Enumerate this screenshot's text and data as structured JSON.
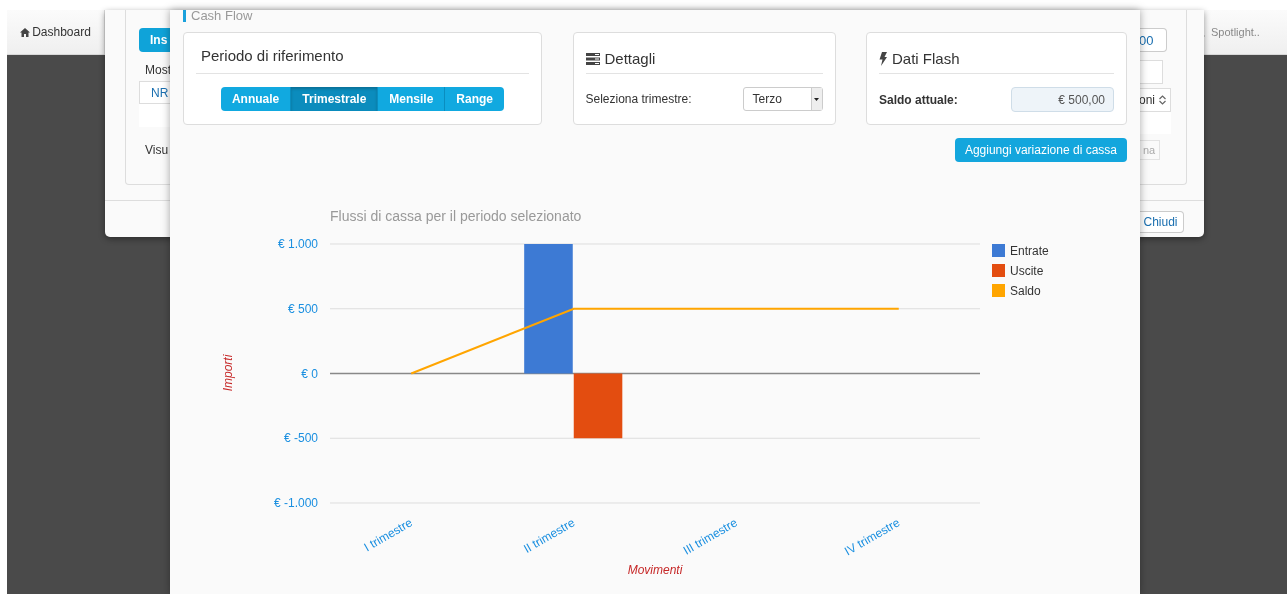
{
  "navbar": {
    "dashboard_button": "Dashboard",
    "search": {
      "placeholder": "Spotlight.."
    }
  },
  "background_modal": {
    "left_button": "Ins",
    "left_text_1": "Most",
    "table_header": "NR",
    "left_text_2": "Visu",
    "right_field_value": "00",
    "right_select_value": "oni",
    "right_button": {
      "label": "na",
      "disabled": true
    },
    "close_button": "Chiudi"
  },
  "modal": {
    "title": "Cash Flow",
    "period_panel": {
      "title": "Periodo di riferimento",
      "options": [
        {
          "label": "Annuale",
          "selected": false
        },
        {
          "label": "Trimestrale",
          "selected": true
        },
        {
          "label": "Mensile",
          "selected": false
        },
        {
          "label": "Range",
          "selected": false
        }
      ]
    },
    "details_panel": {
      "title": "Dettagli",
      "label": "Seleziona trimestre:",
      "select_value": "Terzo"
    },
    "flash_panel": {
      "title": "Dati Flash",
      "label": "Saldo attuale:",
      "value": "€ 500,00"
    },
    "add_button": "Aggiungi variazione di cassa",
    "chart": {
      "chart_data": {
        "type": "bar",
        "title": "Flussi di cassa per il periodo selezionato",
        "xlabel": "Movimenti",
        "ylabel": "Importi",
        "categories": [
          "I trimestre",
          "II trimestre",
          "III trimestre",
          "IV trimestre"
        ],
        "series": [
          {
            "name": "Entrate",
            "color": "#3d7ad4",
            "values": [
              0,
              1000,
              0,
              0
            ]
          },
          {
            "name": "Uscite",
            "color": "#e34d10",
            "values": [
              0,
              -500,
              0,
              0
            ]
          },
          {
            "name": "Saldo",
            "color": "#ffa500",
            "type": "line",
            "values": [
              0,
              500,
              500,
              500
            ]
          }
        ],
        "stacked": false,
        "legend": true,
        "ylim": [
          -1000,
          1000
        ],
        "yticks": [
          {
            "value": 1000,
            "label": "€ 1.000"
          },
          {
            "value": 500,
            "label": "€ 500"
          },
          {
            "value": 0,
            "label": "€ 0"
          },
          {
            "value": -500,
            "label": "€ -500"
          },
          {
            "value": -1000,
            "label": "€ -1.000"
          }
        ]
      }
    }
  }
}
